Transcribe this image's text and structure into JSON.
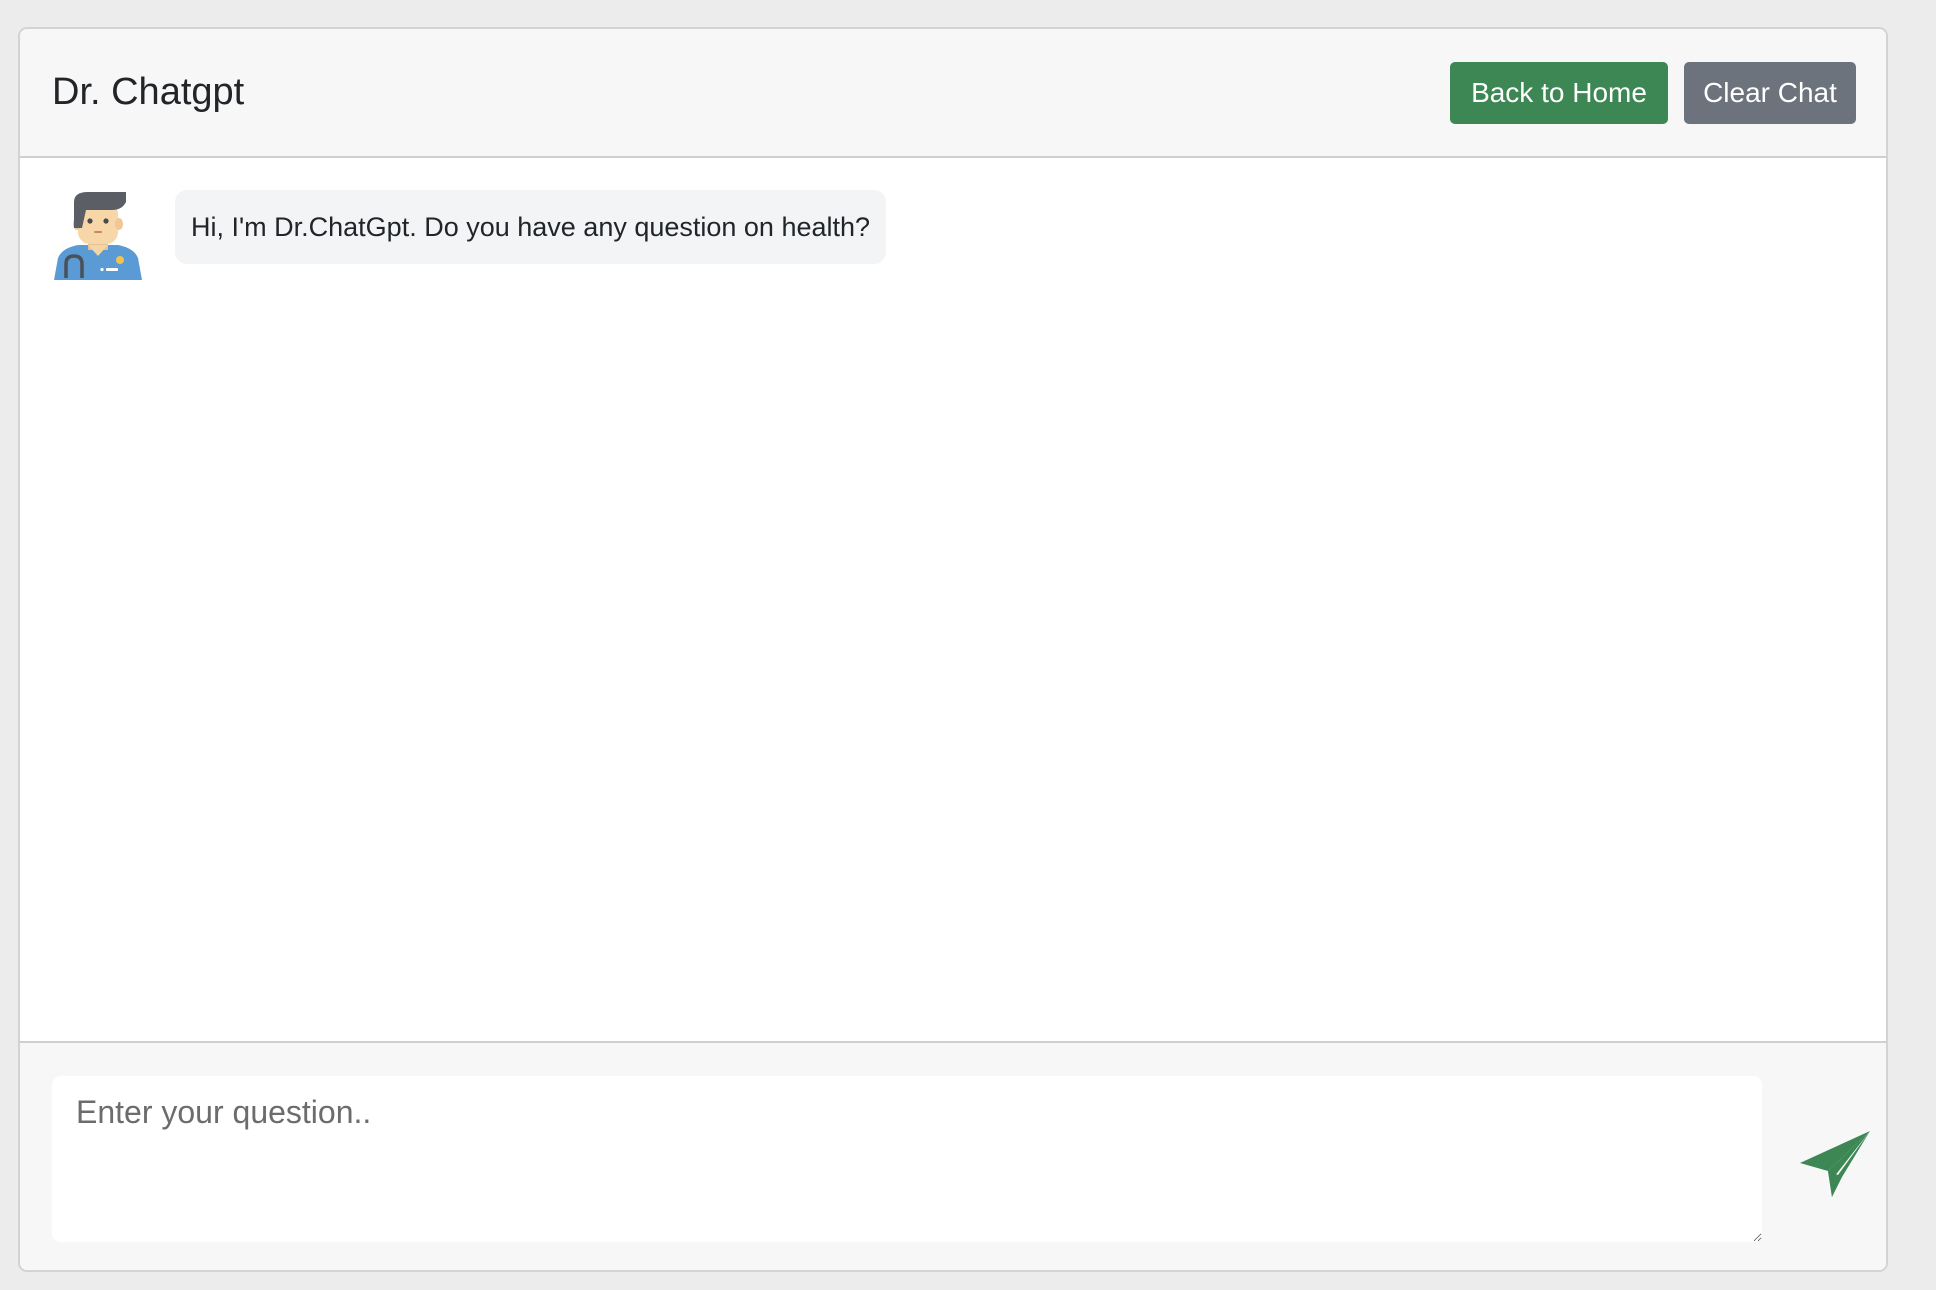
{
  "header": {
    "title": "Dr. Chatgpt",
    "back_label": "Back to Home",
    "clear_label": "Clear Chat"
  },
  "colors": {
    "success": "#3d8754",
    "secondary": "#6c737c"
  },
  "messages": [
    {
      "sender": "doctor",
      "avatar_icon": "doctor-avatar-icon",
      "text": "Hi, I'm Dr.ChatGpt. Do you have any question on health?"
    }
  ],
  "input": {
    "placeholder": "Enter your question..",
    "value": ""
  },
  "send": {
    "icon": "paper-plane-icon"
  }
}
